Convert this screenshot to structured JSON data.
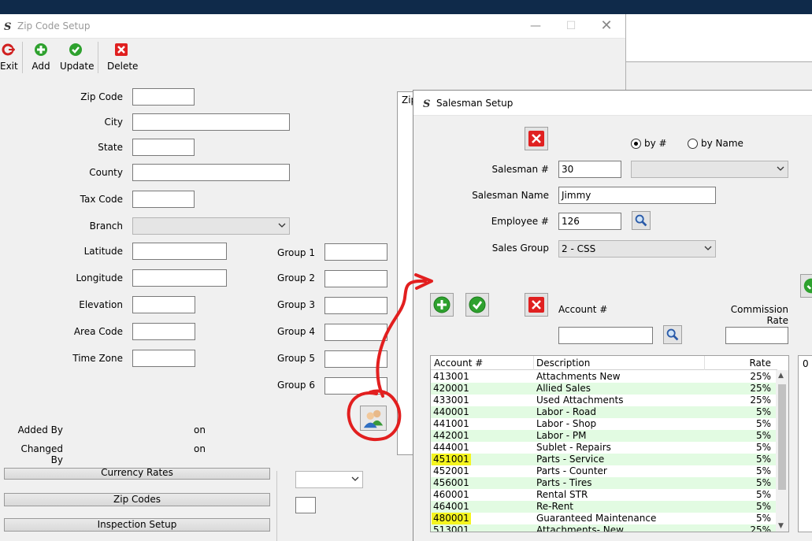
{
  "zip_window": {
    "title": "Zip Code Setup",
    "toolbar": {
      "exit": "Exit",
      "add": "Add",
      "update": "Update",
      "delete": "Delete"
    },
    "fields": {
      "zip_code": "Zip Code",
      "city": "City",
      "state": "State",
      "county": "County",
      "tax_code": "Tax Code",
      "branch": "Branch",
      "latitude": "Latitude",
      "longitude": "Longitude",
      "elevation": "Elevation",
      "area_code": "Area Code",
      "time_zone": "Time Zone"
    },
    "groups": [
      "Group 1",
      "Group 2",
      "Group 3",
      "Group 4",
      "Group 5",
      "Group 6"
    ],
    "added_by": "Added By",
    "changed_by": "Changed By",
    "on_1": "on",
    "on_2": "on",
    "grid_header_partial": "Zip"
  },
  "background_buttons": {
    "currency_rates": "Currency Rates",
    "zip_codes": "Zip Codes",
    "inspection_setup": "Inspection Setup"
  },
  "salesman_window": {
    "title": "Salesman Setup",
    "radio_by_number": "by #",
    "radio_by_name": "by Name",
    "radio_selected": "by #",
    "salesman_number_label": "Salesman #",
    "salesman_number_value": "30",
    "salesman_name_label": "Salesman Name",
    "salesman_name_value": "Jimmy",
    "employee_number_label": "Employee #",
    "employee_number_value": "126",
    "sales_group_label": "Sales Group",
    "sales_group_value": "2 - CSS",
    "account_label": "Account #",
    "commission_rate_label": "Commission Rate",
    "grid": {
      "columns": [
        "Account #",
        "Description",
        "Rate"
      ],
      "rows": [
        {
          "account": "413001",
          "description": "Attachments New",
          "rate": "25%",
          "highlight": false
        },
        {
          "account": "420001",
          "description": "Allied Sales",
          "rate": "25%",
          "highlight": false
        },
        {
          "account": "433001",
          "description": "Used Attachments",
          "rate": "25%",
          "highlight": false
        },
        {
          "account": "440001",
          "description": "Labor - Road",
          "rate": "5%",
          "highlight": false
        },
        {
          "account": "441001",
          "description": "Labor - Shop",
          "rate": "5%",
          "highlight": false
        },
        {
          "account": "442001",
          "description": "Labor - PM",
          "rate": "5%",
          "highlight": false
        },
        {
          "account": "444001",
          "description": "Sublet - Repairs",
          "rate": "5%",
          "highlight": false
        },
        {
          "account": "451001",
          "description": "Parts - Service",
          "rate": "5%",
          "highlight": true
        },
        {
          "account": "452001",
          "description": "Parts - Counter",
          "rate": "5%",
          "highlight": false
        },
        {
          "account": "456001",
          "description": "Parts - Tires",
          "rate": "5%",
          "highlight": false
        },
        {
          "account": "460001",
          "description": "Rental STR",
          "rate": "5%",
          "highlight": false
        },
        {
          "account": "464001",
          "description": "Re-Rent",
          "rate": "5%",
          "highlight": false
        },
        {
          "account": "480001",
          "description": "Guaranteed Maintenance",
          "rate": "5%",
          "highlight": true
        },
        {
          "account": "513001",
          "description": "Attachments- New",
          "rate": "25%",
          "highlight": false
        }
      ]
    },
    "right_grid_value": "0"
  },
  "colors": {
    "alt_row": "#e2fbe2",
    "highlight": "#f5f51f",
    "annotation_red": "#e21f1f"
  }
}
